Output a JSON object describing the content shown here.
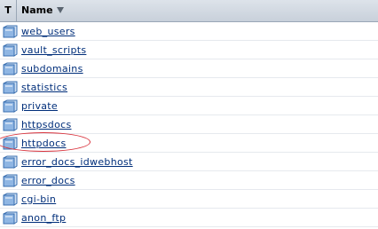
{
  "table": {
    "columns": {
      "type_header": "T",
      "name_header": "Name"
    },
    "sort_icon": "sort-descending-icon",
    "row_icon": "folder-icon",
    "rows": [
      {
        "name": "web_users"
      },
      {
        "name": "vault_scripts"
      },
      {
        "name": "subdomains"
      },
      {
        "name": "statistics"
      },
      {
        "name": "private"
      },
      {
        "name": "httpsdocs"
      },
      {
        "name": "httpdocs",
        "highlighted": true
      },
      {
        "name": "error_docs_idwebhost"
      },
      {
        "name": "error_docs"
      },
      {
        "name": "cgi-bin"
      },
      {
        "name": "anon_ftp"
      }
    ]
  },
  "colors": {
    "header_bg": "#d3d9e1",
    "link": "#002e7a",
    "highlight_circle": "#d8303a",
    "folder_blue": "#6d9bd1"
  }
}
